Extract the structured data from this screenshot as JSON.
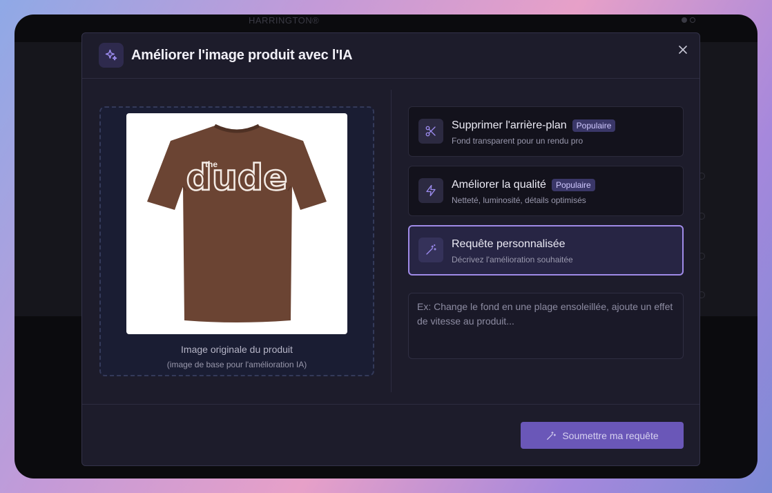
{
  "background": {
    "brand": "HARRINGTON®"
  },
  "modal": {
    "title": "Améliorer l'image produit avec l'IA",
    "image_panel": {
      "caption": "Image originale du produit",
      "subcaption": "(image de base pour l'amélioration IA)",
      "shirt_graphic_small": "the",
      "shirt_graphic_large": "dude"
    },
    "options": [
      {
        "title": "Supprimer l'arrière-plan",
        "badge": "Populaire",
        "description": "Fond transparent pour un rendu pro",
        "icon": "scissors-icon"
      },
      {
        "title": "Améliorer la qualité",
        "badge": "Populaire",
        "description": "Netteté, luminosité, détails optimisés",
        "icon": "lightning-icon"
      },
      {
        "title": "Requête personnalisée",
        "description": "Décrivez l'amélioration souhaitée",
        "icon": "magic-wand-icon",
        "selected": true
      }
    ],
    "prompt": {
      "placeholder": "Ex: Change le fond en une plage ensoleillée, ajoute un effet de vitesse au produit...",
      "value": ""
    },
    "submit_label": "Soumettre ma requête"
  },
  "colors": {
    "accent": "#a08be8",
    "button": "#6a57b8",
    "badge_bg": "#3a3768"
  }
}
